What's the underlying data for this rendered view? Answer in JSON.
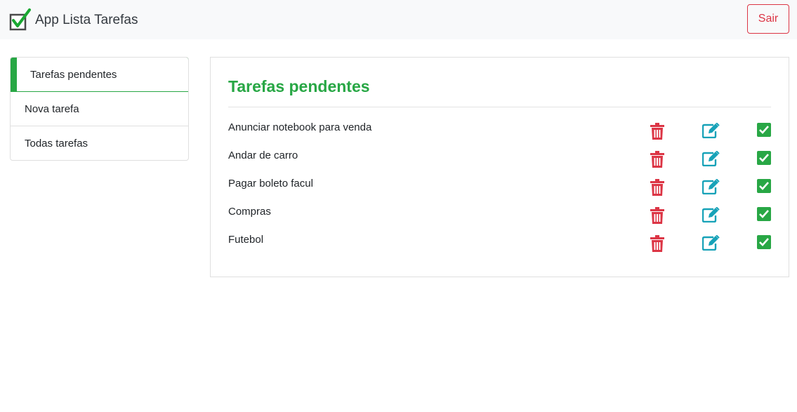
{
  "app": {
    "title": "App Lista Tarefas",
    "logout_label": "Sair"
  },
  "colors": {
    "accent_green": "#28a745",
    "danger_red": "#dc3545",
    "info_blue": "#17a2b8",
    "navbar_bg": "#f8f9fa"
  },
  "sidebar": {
    "items": [
      {
        "label": "Tarefas pendentes",
        "active": true
      },
      {
        "label": "Nova tarefa",
        "active": false
      },
      {
        "label": "Todas tarefas",
        "active": false
      }
    ]
  },
  "main": {
    "title": "Tarefas pendentes",
    "tasks": [
      {
        "text": "Anunciar notebook para venda"
      },
      {
        "text": "Andar de carro"
      },
      {
        "text": "Pagar boleto facul"
      },
      {
        "text": "Compras"
      },
      {
        "text": "Futebol"
      }
    ],
    "action_icons": [
      "trash-icon",
      "edit-icon",
      "check-square-icon"
    ]
  }
}
